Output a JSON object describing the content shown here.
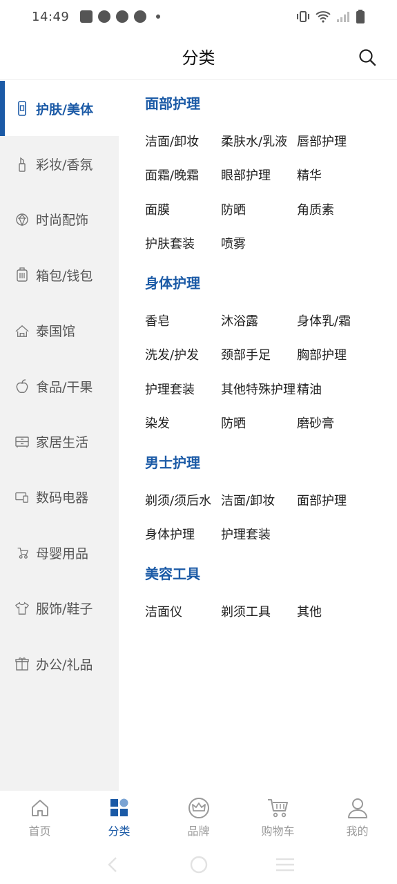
{
  "status_bar": {
    "time": "14:49"
  },
  "header": {
    "title": "分类"
  },
  "colors": {
    "accent": "#1b5aa6",
    "sidebar_bg": "#f2f2f2",
    "inactive": "#999999"
  },
  "sidebar": {
    "items": [
      {
        "label": "护肤/美体",
        "icon": "lotion-bottle-icon"
      },
      {
        "label": "彩妆/香氛",
        "icon": "lipstick-icon"
      },
      {
        "label": "时尚配饰",
        "icon": "gem-icon"
      },
      {
        "label": "箱包/钱包",
        "icon": "luggage-icon"
      },
      {
        "label": "泰国馆",
        "icon": "temple-icon"
      },
      {
        "label": "食品/干果",
        "icon": "fruit-icon"
      },
      {
        "label": "家居生活",
        "icon": "cabinet-icon"
      },
      {
        "label": "数码电器",
        "icon": "devices-icon"
      },
      {
        "label": "母婴用品",
        "icon": "stroller-icon"
      },
      {
        "label": "服饰/鞋子",
        "icon": "shirt-icon"
      },
      {
        "label": "办公/礼品",
        "icon": "gift-icon"
      }
    ]
  },
  "sections": [
    {
      "title": "面部护理",
      "items": [
        "洁面/卸妆",
        "柔肤水/乳液",
        "唇部护理",
        "面霜/晚霜",
        "眼部护理",
        "精华",
        "面膜",
        "防晒",
        "角质素",
        "护肤套装",
        "喷雾"
      ]
    },
    {
      "title": "身体护理",
      "items": [
        "香皂",
        "沐浴露",
        "身体乳/霜",
        "洗发/护发",
        "颈部手足",
        "胸部护理",
        "护理套装",
        "其他特殊护理",
        "精油",
        "染发",
        "防晒",
        "磨砂膏"
      ]
    },
    {
      "title": "男士护理",
      "items": [
        "剃须/须后水",
        "洁面/卸妆",
        "面部护理",
        "身体护理",
        "护理套装"
      ]
    },
    {
      "title": "美容工具",
      "items": [
        "洁面仪",
        "剃须工具",
        "其他"
      ]
    }
  ],
  "bottom_nav": {
    "items": [
      {
        "label": "首页",
        "icon": "home-icon"
      },
      {
        "label": "分类",
        "icon": "category-grid-icon"
      },
      {
        "label": "品牌",
        "icon": "crown-icon"
      },
      {
        "label": "购物车",
        "icon": "cart-icon"
      },
      {
        "label": "我的",
        "icon": "user-icon"
      }
    ]
  }
}
